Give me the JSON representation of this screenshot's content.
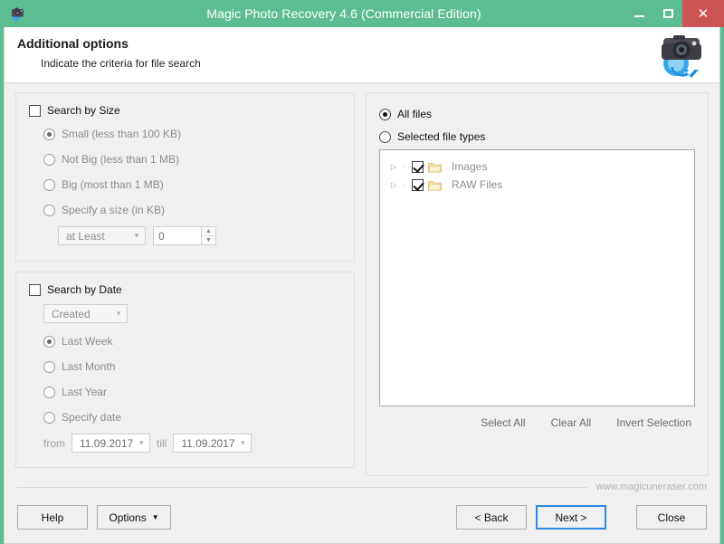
{
  "window": {
    "title": "Magic Photo Recovery 4.6 (Commercial Edition)",
    "app_icon": "camera-icon",
    "minimize_label": "",
    "maximize_label": "",
    "close_label": "✕",
    "titlebar_color": "#5cbd92",
    "close_button_color": "#cc5454"
  },
  "header": {
    "title": "Additional options",
    "subtitle": "Indicate the criteria for file search",
    "logo": "camera-recovery-logo"
  },
  "search_by_size": {
    "checkbox_label": "Search by Size",
    "checked": false,
    "options": [
      {
        "label": "Small (less than 100 KB)",
        "selected": true
      },
      {
        "label": "Not Big (less than 1 MB)",
        "selected": false
      },
      {
        "label": "Big (most than 1 MB)",
        "selected": false
      },
      {
        "label": "Specify a size (in KB)",
        "selected": false
      }
    ],
    "comparator_value": "at Least",
    "size_value": "0"
  },
  "search_by_date": {
    "checkbox_label": "Search by Date",
    "checked": false,
    "date_field_value": "Created",
    "options": [
      {
        "label": "Last Week",
        "selected": true
      },
      {
        "label": "Last Month",
        "selected": false
      },
      {
        "label": "Last Year",
        "selected": false
      },
      {
        "label": "Specify date",
        "selected": false
      }
    ],
    "from_label": "from",
    "from_value": "11.09.2017",
    "till_label": "till",
    "till_value": "11.09.2017"
  },
  "file_types": {
    "all_files_label": "All files",
    "all_files_selected": true,
    "selected_types_label": "Selected file types",
    "selected_types_selected": false,
    "tree": [
      {
        "label": "Images",
        "checked": true,
        "expandable": true
      },
      {
        "label": "RAW Files",
        "checked": true,
        "expandable": true
      }
    ],
    "actions": [
      {
        "label": "Select All"
      },
      {
        "label": "Clear All"
      },
      {
        "label": "Invert Selection"
      }
    ]
  },
  "footer": {
    "website": "www.magicuneraser.com",
    "buttons": {
      "help": "Help",
      "options": "Options",
      "options_caret": "▼",
      "back": "< Back",
      "next": "Next >",
      "close": "Close"
    }
  }
}
